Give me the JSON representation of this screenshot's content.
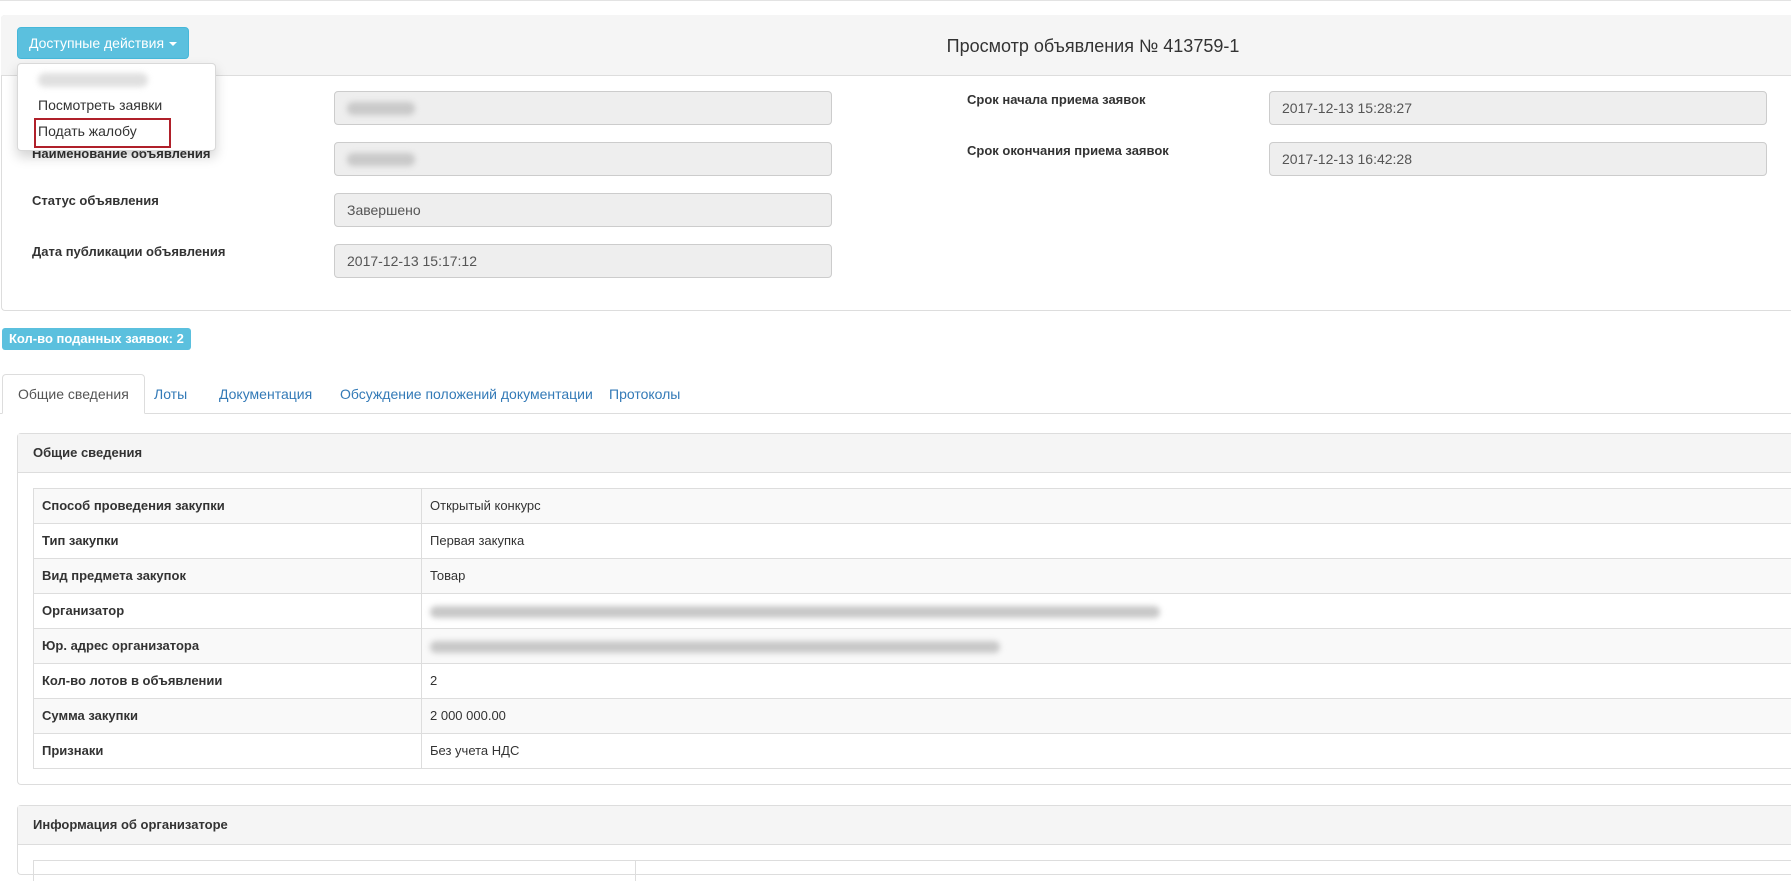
{
  "header": {
    "title": "Просмотр объявления № 413759-1",
    "actions_button": "Доступные действия",
    "dropdown": {
      "items": [
        "Посмотреть заявки",
        "Подать жалобу"
      ]
    }
  },
  "fields": {
    "name_label": "Наименование объявления",
    "status_label": "Статус объявления",
    "status_value": "Завершено",
    "pub_date_label": "Дата публикации объявления",
    "pub_date_value": "2017-12-13 15:17:12",
    "start_label": "Срок начала приема заявок",
    "start_value": "2017-12-13 15:28:27",
    "end_label": "Срок окончания приема заявок",
    "end_value": "2017-12-13 16:42:28"
  },
  "count_badge": "Кол-во поданных заявок: 2",
  "tabs": [
    {
      "label": "Общие сведения",
      "active": true
    },
    {
      "label": "Лоты"
    },
    {
      "label": "Документация"
    },
    {
      "label": "Обсуждение положений документации"
    },
    {
      "label": "Протоколы"
    }
  ],
  "general": {
    "title": "Общие сведения",
    "rows": [
      {
        "key": "Способ проведения закупки",
        "value": "Открытый конкурс"
      },
      {
        "key": "Тип закупки",
        "value": "Первая закупка"
      },
      {
        "key": "Вид предмета закупок",
        "value": "Товар"
      },
      {
        "key": "Организатор",
        "value": ""
      },
      {
        "key": "Юр. адрес организатора",
        "value": ""
      },
      {
        "key": "Кол-во лотов в объявлении",
        "value": "2"
      },
      {
        "key": "Сумма закупки",
        "value": "2 000 000.00"
      },
      {
        "key": "Признаки",
        "value": "Без учета НДС"
      }
    ]
  },
  "organizer_panel": {
    "title": "Информация об организаторе"
  },
  "colors": {
    "info": "#5bc0de",
    "link": "#337ab7",
    "highlight": "#b0202a"
  }
}
